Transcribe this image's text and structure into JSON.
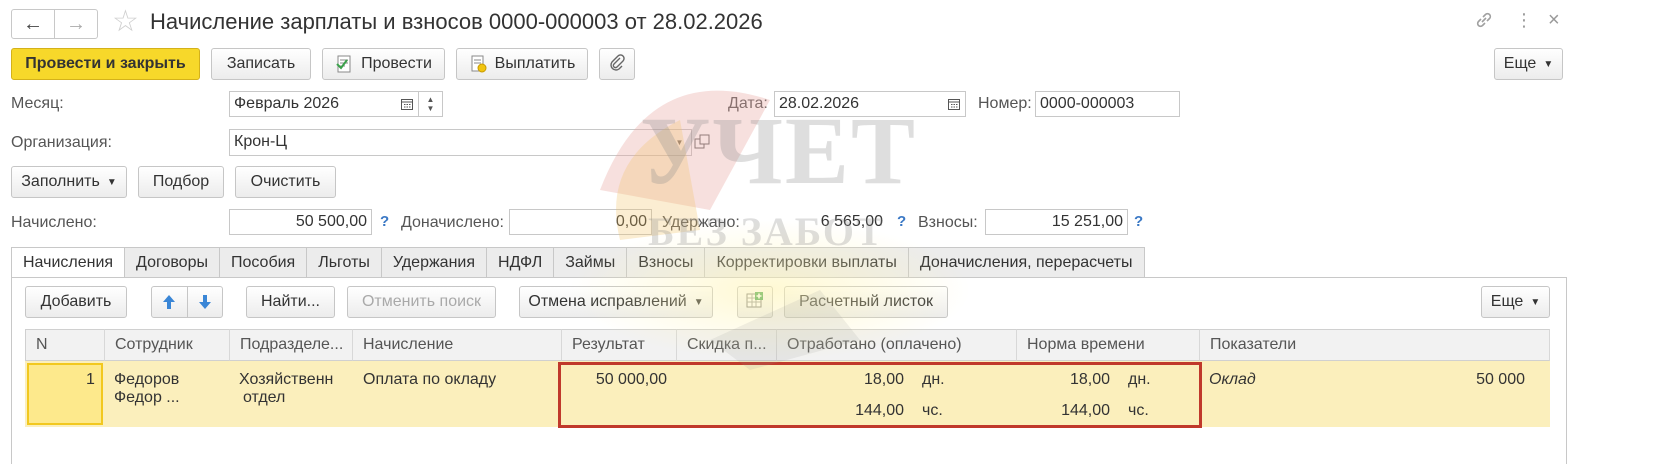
{
  "header": {
    "title": "Начисление зарплаты и взносов 0000-000003 от 28.02.2026",
    "back_icon": "←",
    "forward_icon": "→",
    "star_icon": "☆",
    "link_icon": "🔗",
    "more_icon": "⋮",
    "close_icon": "×"
  },
  "toolbar": {
    "post_and_close": "Провести и закрыть",
    "save": "Записать",
    "post": "Провести",
    "pay": "Выплатить",
    "more": "Еще"
  },
  "form": {
    "month_label": "Месяц:",
    "month_value": "Февраль 2026",
    "date_label": "Дата:",
    "date_value": "28.02.2026",
    "number_label": "Номер:",
    "number_value": "0000-000003",
    "org_label": "Организация:",
    "org_value": "Крон-Ц",
    "fill_button": "Заполнить",
    "pick_button": "Подбор",
    "clear_button": "Очистить",
    "accrued_label": "Начислено:",
    "accrued_value": "50 500,00",
    "additional_label": "Доначислено:",
    "additional_value": "0,00",
    "withheld_label": "Удержано:",
    "withheld_value": "6 565,00",
    "contributions_label": "Взносы:",
    "contributions_value": "15 251,00",
    "help_mark": "?"
  },
  "tabs": [
    "Начисления",
    "Договоры",
    "Пособия",
    "Льготы",
    "Удержания",
    "НДФЛ",
    "Займы",
    "Взносы",
    "Корректировки выплаты",
    "Доначисления, перерасчеты"
  ],
  "table_toolbar": {
    "add": "Добавить",
    "find": "Найти...",
    "cancel_search": "Отменить поиск",
    "cancel_corrections": "Отмена исправлений",
    "payslip": "Расчетный листок",
    "more": "Еще"
  },
  "table": {
    "headers": [
      "N",
      "Сотрудник",
      "Подразделе...",
      "Начисление",
      "Результат",
      "Скидка п...",
      "Отработано (оплачено)",
      "Норма времени",
      "Показатели"
    ],
    "row": {
      "n": "1",
      "employee_line1": "Федоров",
      "employee_line2": "Федор ...",
      "dept_line1": "Хозяйственн",
      "dept_line2": "отдел",
      "accrual": "Оплата по окладу",
      "result": "50 000,00",
      "worked_days": "18,00",
      "days_unit": "дн.",
      "worked_hours": "144,00",
      "hours_unit": "чс.",
      "norm_days": "18,00",
      "norm_hours": "144,00",
      "indicator_name": "Оклад",
      "indicator_value": "50 000"
    }
  },
  "watermark": {
    "line1": "УЧЕТ",
    "line2": "БЕЗ ЗАБОТ"
  },
  "colors": {
    "primary_button": "#f7d82a",
    "selected_row": "#fbefbc",
    "highlight_frame": "#c0392b",
    "help_mark": "#3a78c5"
  }
}
